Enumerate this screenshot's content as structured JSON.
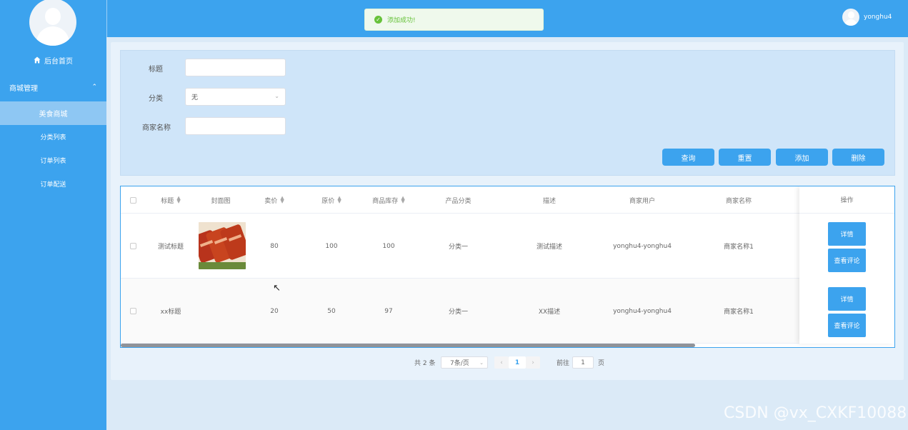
{
  "sidebar": {
    "home_label": "后台首页",
    "group_label": "商城管理",
    "items": [
      {
        "label": "美食商城",
        "active": true
      },
      {
        "label": "分类列表",
        "active": false
      },
      {
        "label": "订单列表",
        "active": false
      },
      {
        "label": "订单配送",
        "active": false
      }
    ]
  },
  "header": {
    "toast": "添加成功!",
    "username": "yonghu4"
  },
  "search": {
    "title_label": "标题",
    "title_value": "",
    "category_label": "分类",
    "category_value": "无",
    "merchant_label": "商家名称",
    "merchant_value": ""
  },
  "actions": {
    "query": "查询",
    "reset": "重置",
    "add": "添加",
    "delete": "删除"
  },
  "table": {
    "columns": [
      "标题",
      "封面图",
      "卖价",
      "原价",
      "商品库存",
      "产品分类",
      "描述",
      "商家用户",
      "商家名称",
      "操作"
    ],
    "rows": [
      {
        "title": "测试标题",
        "price": "80",
        "original": "100",
        "stock": "100",
        "category": "分类一",
        "desc": "测试描述",
        "user": "yonghu4-yonghu4",
        "merchant": "商家名称1"
      },
      {
        "title": "xx标题",
        "price": "20",
        "original": "50",
        "stock": "97",
        "category": "分类一",
        "desc": "XX描述",
        "user": "yonghu4-yonghu4",
        "merchant": "商家名称1"
      }
    ],
    "detail_label": "详情",
    "comment_label": "查看评论"
  },
  "pagination": {
    "total": "共 2 条",
    "page_size": "7条/页",
    "current": "1",
    "goto_label": "前往",
    "goto_value": "1",
    "page_suffix": "页"
  },
  "watermark": "CSDN @vx_CXKF10088",
  "colors": {
    "primary": "#3ca3ee",
    "success": "#67c23a"
  }
}
